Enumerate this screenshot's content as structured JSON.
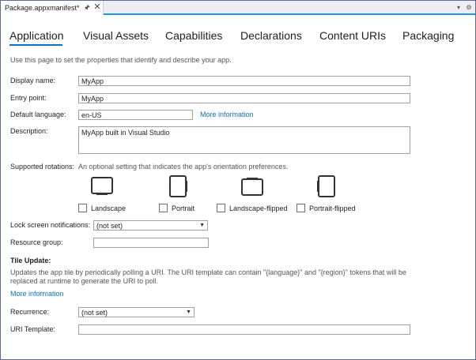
{
  "tab": {
    "title": "Package.appxmanifest*",
    "pin_icon": "pin-icon",
    "close_icon": "close-icon"
  },
  "strip": {
    "dropdown_icon": "chevron-down-icon",
    "settings_icon": "gear-icon"
  },
  "pivot": [
    "Application",
    "Visual Assets",
    "Capabilities",
    "Declarations",
    "Content URIs",
    "Packaging"
  ],
  "intro": "Use this page to set the properties that identify and describe your app.",
  "display_name": {
    "label": "Display name:",
    "value": "MyApp"
  },
  "entry_point": {
    "label": "Entry point:",
    "value": "MyApp"
  },
  "default_language": {
    "label": "Default language:",
    "value": "en-US",
    "link": "More information"
  },
  "description": {
    "label": "Description:",
    "value": "MyApp built in Visual Studio"
  },
  "rotations": {
    "label": "Supported rotations:",
    "hint": "An optional setting that indicates the app's orientation preferences.",
    "options": [
      {
        "label": "Landscape",
        "checked": false,
        "icon": "landscape-icon"
      },
      {
        "label": "Portrait",
        "checked": false,
        "icon": "portrait-icon"
      },
      {
        "label": "Landscape-flipped",
        "checked": false,
        "icon": "landscape-flipped-icon"
      },
      {
        "label": "Portrait-flipped",
        "checked": false,
        "icon": "portrait-flipped-icon"
      }
    ]
  },
  "lock_screen": {
    "label": "Lock screen notifications:",
    "value": "(not set)"
  },
  "resource_group": {
    "label": "Resource group:",
    "value": ""
  },
  "tile_update": {
    "title": "Tile Update:",
    "description": "Updates the app tile by periodically polling a URI. The URI template can contain \"{language}\" and \"{region}\" tokens that will be replaced at runtime to generate the URI to poll.",
    "link": "More information"
  },
  "recurrence": {
    "label": "Recurrence:",
    "value": "(not set)"
  },
  "uri_template": {
    "label": "URI Template:",
    "value": ""
  },
  "colors": {
    "accent": "#0e70c0",
    "tab_underline": "#1c97ea"
  }
}
